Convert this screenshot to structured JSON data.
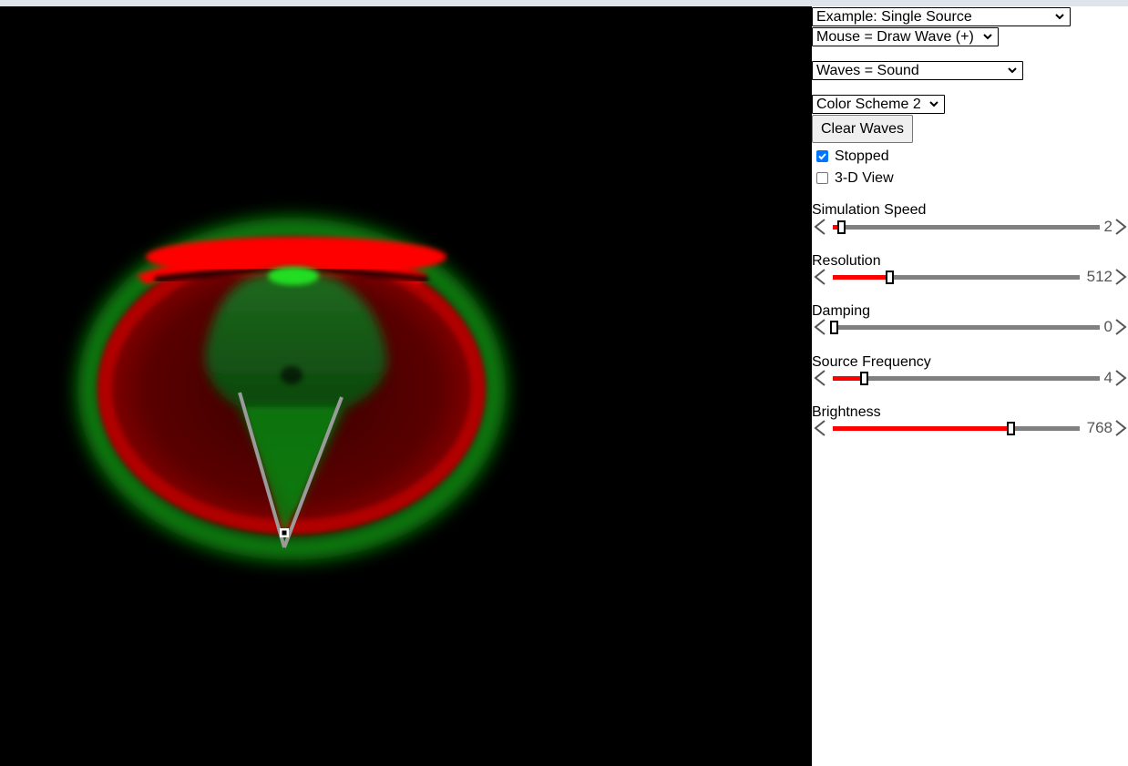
{
  "controls": {
    "example": "Example: Single Source",
    "mouse_mode": "Mouse = Draw Wave (+)",
    "wave_type": "Waves = Sound",
    "color_scheme": "Color Scheme 2",
    "clear_button": "Clear Waves",
    "stopped_label": "Stopped",
    "stopped_checked": true,
    "view3d_label": "3-D View",
    "view3d_checked": false
  },
  "sliders": [
    {
      "label": "Simulation Speed",
      "value": "2",
      "fill_fraction": 0.03
    },
    {
      "label": "Resolution",
      "value": "512",
      "fill_fraction": 0.22
    },
    {
      "label": "Damping",
      "value": "0",
      "fill_fraction": 0.0
    },
    {
      "label": "Source Frequency",
      "value": "4",
      "fill_fraction": 0.11
    },
    {
      "label": "Brightness",
      "value": "768",
      "fill_fraction": 0.71
    }
  ],
  "colors": {
    "wave_positive": "#ff0000",
    "wave_negative": "#00c000",
    "wall": "#9a9a9a",
    "background": "#000000",
    "slider_fill": "#ff0000",
    "slider_track": "#808080",
    "checkbox_accent": "#0075ff"
  }
}
